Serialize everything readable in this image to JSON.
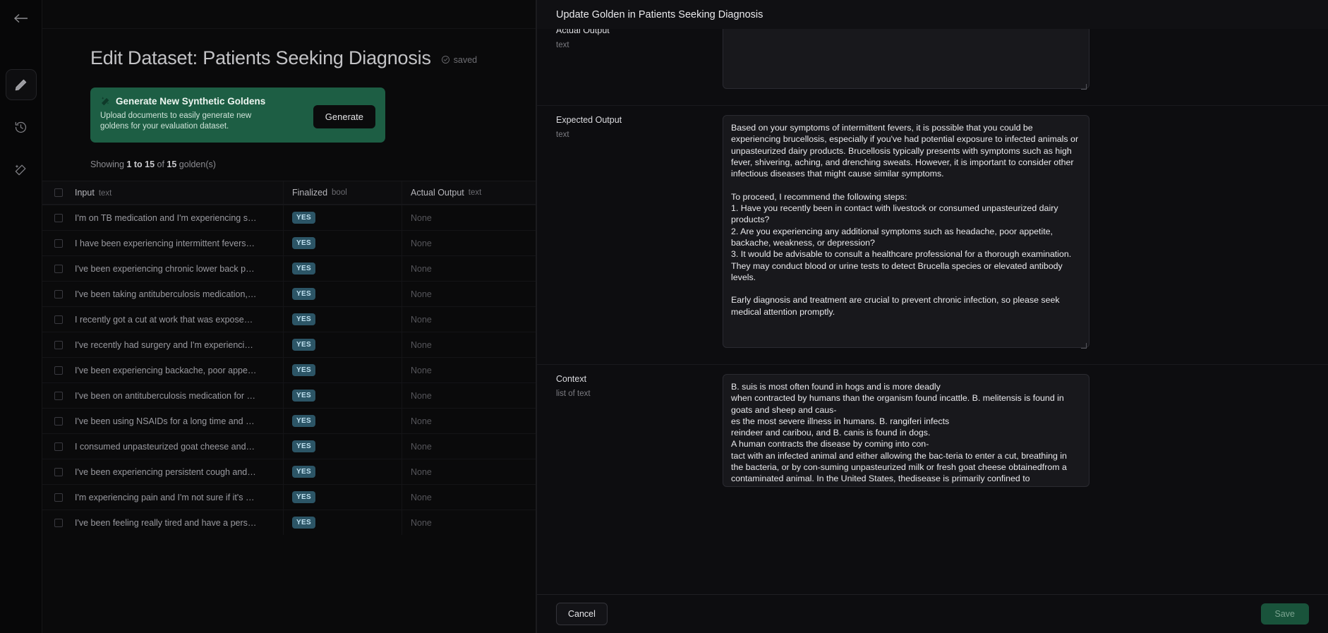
{
  "rail": {
    "back_icon": "arrow-left-icon",
    "items": [
      {
        "icon": "pencil-icon",
        "name": "edit",
        "active": true
      },
      {
        "icon": "history-clock-icon",
        "name": "history",
        "active": false
      },
      {
        "icon": "magic-wand-icon",
        "name": "generate",
        "active": false
      }
    ]
  },
  "page": {
    "title": "Edit Dataset: Patients Seeking Diagnosis",
    "saved_label": "saved",
    "saved_icon": "check-circle-icon"
  },
  "promo": {
    "icon": "magic-wand-icon",
    "title": "Generate New Synthetic Goldens",
    "subtitle": "Upload documents to easily generate new goldens for your evaluation dataset.",
    "button_label": "Generate",
    "bg_color": "#1d5e44"
  },
  "showing": {
    "prefix": "Showing ",
    "range": "1 to 15",
    "middle": " of ",
    "total": "15",
    "suffix": " golden(s)"
  },
  "table": {
    "columns": [
      {
        "name": "Input",
        "type": "text"
      },
      {
        "name": "Finalized",
        "type": "bool"
      },
      {
        "name": "Actual Output",
        "type": "text"
      }
    ],
    "rows": [
      {
        "input": "I'm on TB medication and I'm experiencing some si...",
        "finalized": "YES",
        "actual_output": "None"
      },
      {
        "input": "I have been experiencing intermittent fevers and I'...",
        "finalized": "YES",
        "actual_output": "None"
      },
      {
        "input": "I've been experiencing chronic lower back pain, an...",
        "finalized": "YES",
        "actual_output": "None"
      },
      {
        "input": "I've been taking antituberculosis medication, but I'...",
        "finalized": "YES",
        "actual_output": "None"
      },
      {
        "input": "I recently got a cut at work that was exposed to ani...",
        "finalized": "YES",
        "actual_output": "None"
      },
      {
        "input": "I've recently had surgery and I'm experiencing pain...",
        "finalized": "YES",
        "actual_output": "None"
      },
      {
        "input": "I've been experiencing backache, poor appetite, an...",
        "finalized": "YES",
        "actual_output": "None"
      },
      {
        "input": "I've been on antituberculosis medication for a while...",
        "finalized": "YES",
        "actual_output": "None"
      },
      {
        "input": "I've been using NSAIDs for a long time and now I'...",
        "finalized": "YES",
        "actual_output": "None"
      },
      {
        "input": "I consumed unpasteurized goat cheese and now I'...",
        "finalized": "YES",
        "actual_output": "None"
      },
      {
        "input": "I've been experiencing persistent cough and fatigu...",
        "finalized": "YES",
        "actual_output": "None"
      },
      {
        "input": "I'm experiencing pain and I'm not sure if it's due to ...",
        "finalized": "YES",
        "actual_output": "None"
      },
      {
        "input": "I've been feeling really tired and have a persistent ...",
        "finalized": "YES",
        "actual_output": "None"
      }
    ]
  },
  "modal": {
    "title": "Update Golden in Patients Seeking Diagnosis",
    "fields": [
      {
        "name": "Actual Output",
        "type": "text",
        "value": ""
      },
      {
        "name": "Expected Output",
        "type": "text",
        "value": "Based on your symptoms of intermittent fevers, it is possible that you could be experiencing brucellosis, especially if you've had potential exposure to infected animals or unpasteurized dairy products. Brucellosis typically presents with symptoms such as high fever, shivering, aching, and drenching sweats. However, it is important to consider other infectious diseases that might cause similar symptoms.\n\nTo proceed, I recommend the following steps:\n1. Have you recently been in contact with livestock or consumed unpasteurized dairy products?\n2. Are you experiencing any additional symptoms such as headache, poor appetite, backache, weakness, or depression?\n3. It would be advisable to consult a healthcare professional for a thorough examination. They may conduct blood or urine tests to detect Brucella species or elevated antibody levels.\n\nEarly diagnosis and treatment are crucial to prevent chronic infection, so please seek medical attention promptly."
      },
      {
        "name": "Context",
        "type": "list of text",
        "value": "B. suis is most often found in hogs and is more deadly\nwhen contracted by humans than the organism found incattle. B. melitensis is found in goats and sheep and caus-\nes the most severe illness in humans. B. rangiferi infects\nreindeer and caribou, and B. canis is found in dogs.\nA human contracts the disease by coming into con-\ntact with an infected animal and either allowing the bac-teria to enter a cut, breathing in the bacteria, or by con-suming unpasteurized milk or fresh goat cheese obtainedfrom a\ncontaminated animal. In the United States, thedisease is primarily confined to slaughterhouse"
      }
    ],
    "cancel_label": "Cancel",
    "save_label": "Save"
  }
}
